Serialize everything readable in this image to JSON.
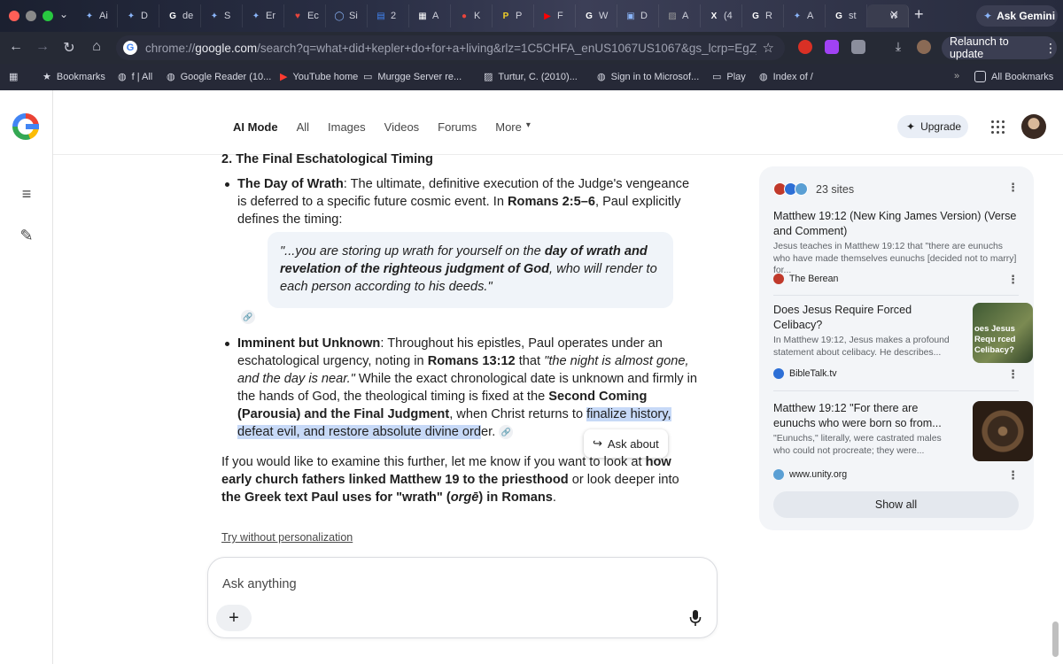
{
  "browser": {
    "tabs": [
      {
        "icon": "gemini-icon",
        "label": "Ai",
        "color": "#8ab4f8"
      },
      {
        "icon": "gemini-icon",
        "label": "D",
        "color": "#8ab4f8"
      },
      {
        "icon": "google-icon",
        "label": "de",
        "color": "#ffffff"
      },
      {
        "icon": "gemini-icon",
        "label": "S",
        "color": "#8ab4f8"
      },
      {
        "icon": "gemini-icon",
        "label": "Er",
        "color": "#8ab4f8"
      },
      {
        "icon": "heart-icon",
        "label": "Ec",
        "color": "#e8453c"
      },
      {
        "icon": "circle-icon",
        "label": "Si",
        "color": "#8ab4f8"
      },
      {
        "icon": "docs-icon",
        "label": "2",
        "color": "#4285f4"
      },
      {
        "icon": "grid-icon",
        "label": "A",
        "color": "#ffffff"
      },
      {
        "icon": "record-icon",
        "label": "K",
        "color": "#e8453c"
      },
      {
        "icon": "p-icon",
        "label": "P",
        "color": "#f2d027"
      },
      {
        "icon": "youtube-icon",
        "label": "F",
        "color": "#ff0000"
      },
      {
        "icon": "google-icon",
        "label": "W",
        "color": "#ffffff"
      },
      {
        "icon": "clipboard-icon",
        "label": "D",
        "color": "#8ab4f8"
      },
      {
        "icon": "image-icon",
        "label": "A",
        "color": "#9a9a9a"
      },
      {
        "icon": "x-icon",
        "label": "(4",
        "color": "#ffffff"
      },
      {
        "icon": "google-icon",
        "label": "R",
        "color": "#ffffff"
      },
      {
        "icon": "gemini-icon",
        "label": "A",
        "color": "#8ab4f8"
      },
      {
        "icon": "google-icon",
        "label": "st",
        "color": "#ffffff"
      },
      {
        "icon": "blank-icon",
        "label": "w",
        "color": "#ffffff"
      }
    ],
    "ask_gemini": "Ask Gemini",
    "url_prefix": "chrome://",
    "url_host": "google.com",
    "url_path": "/search?q=what+did+kepler+do+for+a+living&rlz=1C5CHFA_enUS1067US1067&gs_lcrp=EgZjaHJvbW...",
    "relaunch": "Relaunch to update",
    "bookmarks": [
      {
        "label": "Bookmarks",
        "icon": "star-icon"
      },
      {
        "label": "f | All",
        "icon": "globe-icon"
      },
      {
        "label": "Google Reader (10...",
        "icon": "globe-icon"
      },
      {
        "label": "YouTube home",
        "icon": "youtube-icon"
      },
      {
        "label": "Murgge Server re...",
        "icon": "folder-icon"
      },
      {
        "label": "Turtur, C. (2010)...",
        "icon": "image-icon"
      },
      {
        "label": "Sign in to Microsof...",
        "icon": "globe-icon"
      },
      {
        "label": "Play",
        "icon": "folder-icon"
      },
      {
        "label": "Index of /",
        "icon": "globe-icon"
      }
    ],
    "all_bookmarks": "All Bookmarks"
  },
  "nav": {
    "tabs": [
      "AI Mode",
      "All",
      "Images",
      "Videos",
      "Forums",
      "More"
    ],
    "upgrade": "Upgrade"
  },
  "answer": {
    "heading": "2. The Final Eschatological Timing",
    "b1_term": "The Day of Wrath",
    "b1_text1": ": The ultimate, definitive execution of the Judge's vengeance is deferred to a specific future cosmic event. In ",
    "b1_ref": "Romans 2:5–6",
    "b1_text2": ", Paul explicitly defines the timing:",
    "quote_a": "\"...you are storing up wrath for yourself on the ",
    "quote_b": "day of wrath and revelation of the righteous judgment of God",
    "quote_c": ", who will render to each person according to his deeds.\"",
    "b2_term": "Imminent but Unknown",
    "b2_text1": ": Throughout his epistles, Paul operates under an eschatological urgency, noting in ",
    "b2_ref": "Romans 13:12",
    "b2_text2": " that ",
    "b2_quote": "\"the night is almost gone, and the day is near.\"",
    "b2_text3": " While the exact chronological date is unknown and firmly in the hands of God, the theological timing is fixed at the ",
    "b2_bold": "Second Coming (Parousia) and the Final Judgment",
    "b2_text4": ", when Christ returns to ",
    "b2_hl": "finalize history, defeat evil, and restore absolute divine ord",
    "b2_text5": "er.",
    "ask_about": "Ask about",
    "closing_1": "If you would like to examine this further, let me know if you want to look at ",
    "closing_b1": "how early church fathers linked Matthew 19 to the priesthood",
    "closing_2": " or look deeper into ",
    "closing_b2": "the Greek text Paul uses for \"wrath\" (",
    "closing_i": "orgē",
    "closing_b3": ") in Romans",
    "closing_3": ".",
    "try_without": "Try without personalization",
    "ask_placeholder": "Ask anything"
  },
  "sources": {
    "count_label": "23 sites",
    "cards": [
      {
        "title": "Matthew 19:12 (New King James Version) (Verse and Comment)",
        "snippet": "Jesus teaches in Matthew 19:12 that \"there are eunuchs who have made themselves eunuchs [decided not to marry] for...",
        "source": "The Berean",
        "color": "#c0392b"
      },
      {
        "title": "Does Jesus Require Forced Celibacy?",
        "snippet": "In Matthew 19:12, Jesus makes a profound statement about celibacy. He describes...",
        "source": "BibleTalk.tv",
        "thumb_text": "oes Jesus Requ rced Celibacy?",
        "color": "#2d6fd6"
      },
      {
        "title": "Matthew 19:12 \"For there are eunuchs who were born so from...",
        "snippet": "\"Eunuchs,\" literally, were castrated males who could not procreate; they were...",
        "source": "www.unity.org",
        "color": "#5a9fd4"
      }
    ],
    "show_all": "Show all"
  }
}
